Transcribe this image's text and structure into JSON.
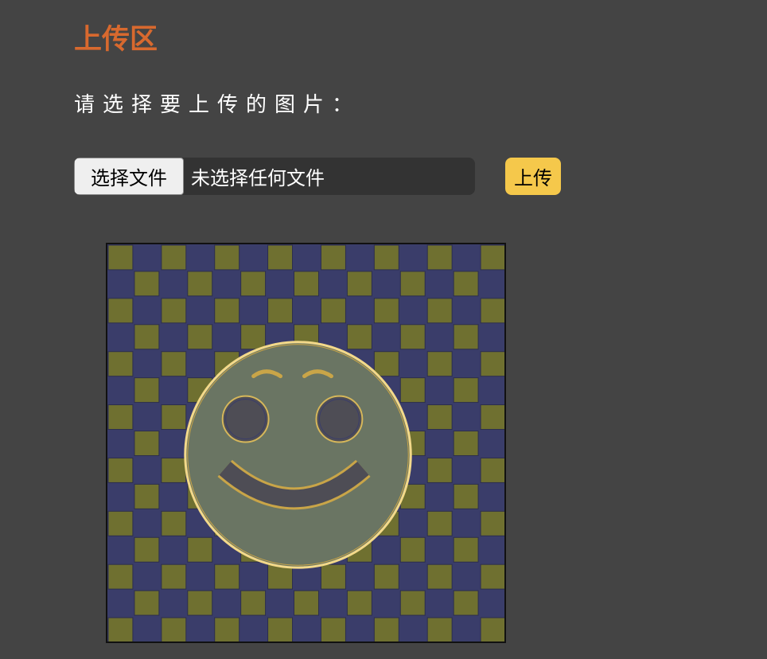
{
  "upload_section": {
    "title": "上传区",
    "prompt": "请选择要上传的图片：",
    "file_picker": {
      "button_label": "选择文件",
      "status": "未选择任何文件"
    },
    "upload_button_label": "上传"
  },
  "preview_image": {
    "icon": "smiley-face-on-checkerboard",
    "colors": {
      "checker_dark": "#3a3d6a",
      "checker_light": "#6f7030",
      "face": "#6a7563",
      "face_outline": "#f3d98a",
      "features": "#4e4d55"
    }
  },
  "colors": {
    "background": "#444444",
    "title": "#d8692e",
    "upload_button": "#f5c84b"
  }
}
